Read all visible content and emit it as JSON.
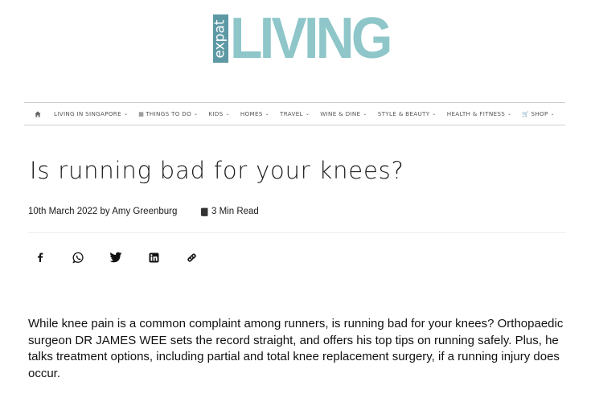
{
  "logo": {
    "small": "expat",
    "big": "LIVING"
  },
  "nav": {
    "items": [
      {
        "label": "LIVING IN SINGAPORE",
        "chevron": true,
        "prefix": ""
      },
      {
        "label": "THINGS TO DO",
        "chevron": true,
        "prefix": "▦"
      },
      {
        "label": "KIDS",
        "chevron": true,
        "prefix": ""
      },
      {
        "label": "HOMES",
        "chevron": true,
        "prefix": ""
      },
      {
        "label": "TRAVEL",
        "chevron": true,
        "prefix": ""
      },
      {
        "label": "WINE & DINE",
        "chevron": true,
        "prefix": ""
      },
      {
        "label": "STYLE & BEAUTY",
        "chevron": true,
        "prefix": ""
      },
      {
        "label": "HEALTH & FITNESS",
        "chevron": true,
        "prefix": ""
      },
      {
        "label": "SHOP",
        "chevron": true,
        "prefix": "🛒"
      }
    ],
    "chevron_glyph": "⌄"
  },
  "article": {
    "title": "Is running bad for your knees?",
    "byline": "10th March 2022 by Amy Greenburg",
    "read_time": "3 Min Read",
    "intro": "While knee pain is a common complaint among runners, is running bad for your knees? Orthopaedic surgeon DR JAMES WEE sets the record straight, and offers his top tips on running safely. Plus, he talks treatment options, including partial and total knee replacement surgery, if a running injury does occur."
  },
  "share": [
    "facebook-icon",
    "whatsapp-icon",
    "twitter-icon",
    "linkedin-icon",
    "link-icon"
  ],
  "colors": {
    "logo_dark": "#5d99a4",
    "logo_light": "#8ec6c9",
    "text": "#1b1b1b"
  }
}
